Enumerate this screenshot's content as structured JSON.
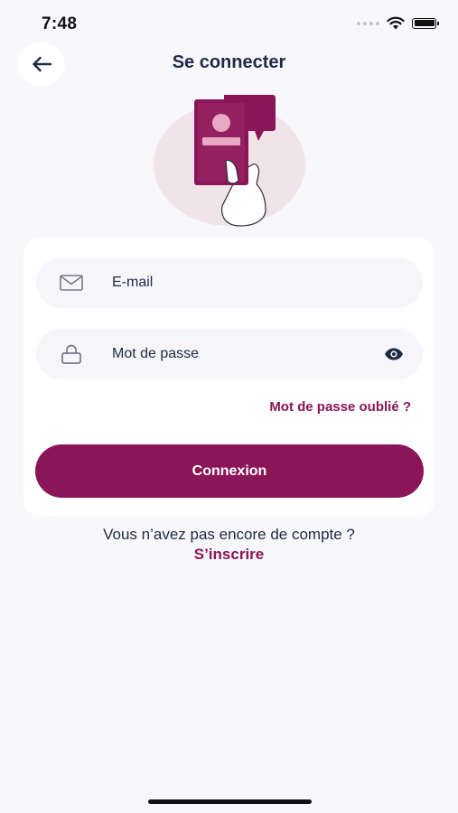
{
  "status_bar": {
    "time": "7:48",
    "icons": [
      "signal-dots-icon",
      "wifi-icon",
      "battery-icon"
    ]
  },
  "header": {
    "back_icon": "arrow-left-icon",
    "title": "Se connecter"
  },
  "illustration": {
    "icon": "phone-in-hand-illustration"
  },
  "form": {
    "email": {
      "icon": "envelope-icon",
      "placeholder": "E-mail"
    },
    "password": {
      "icon": "lock-icon",
      "placeholder": "Mot de passe",
      "toggle_icon": "eye-icon"
    },
    "forgot_password": "Mot de passe oublié ?",
    "submit_label": "Connexion"
  },
  "footer": {
    "no_account_text": "Vous n’avez pas encore de compte ?",
    "signup_link": "S’inscrire"
  },
  "colors": {
    "accent": "#8a1558",
    "text_dark": "#1f2a44",
    "background": "#f7f7fc",
    "field_background": "#f5f5fa"
  }
}
